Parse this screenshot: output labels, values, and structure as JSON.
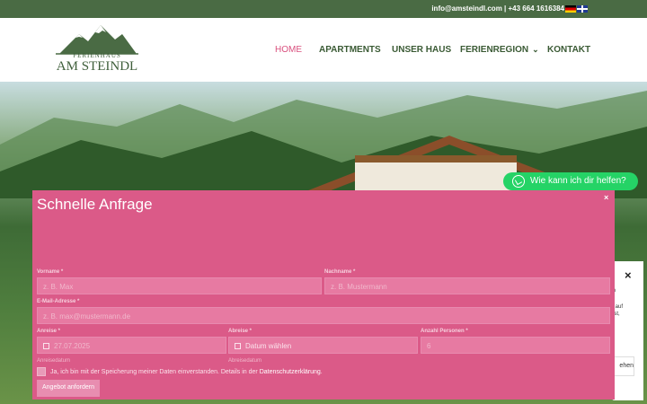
{
  "topbar": {
    "contact": "info@amsteindl.com | +43 664 1616384",
    "languages": [
      "german-flag-icon",
      "english-flag-icon"
    ]
  },
  "logo": {
    "small": "FERIENHAUS",
    "big": "AM STEINDL"
  },
  "nav": [
    {
      "label": "HOME",
      "active": true
    },
    {
      "label": "APARTMENTS"
    },
    {
      "label": "UNSER HAUS"
    },
    {
      "label": "FERIENREGION",
      "has_dropdown": true
    },
    {
      "label": "KONTAKT"
    }
  ],
  "help_widget": {
    "label": "Wie kann ich dir helfen?",
    "icon": "whatsapp-icon"
  },
  "cookie_panel": {
    "close": "×",
    "line1": "m",
    "line2": "s auf",
    "line3": "nst,",
    "line4": ",",
    "button": "ehen"
  },
  "modal": {
    "title": "Schnelle Anfrage",
    "close": "×",
    "fields": {
      "first_name": {
        "label": "Vorname *",
        "placeholder": "z. B. Max"
      },
      "last_name": {
        "label": "Nachname *",
        "placeholder": "z. B. Mustermann"
      },
      "email": {
        "label": "E-Mail-Adresse *",
        "placeholder": "z. B. max@mustermann.de"
      },
      "arrival": {
        "label": "Anreise *",
        "value": "27.07.2025",
        "hint": "Anreisedatum"
      },
      "departure": {
        "label": "Abreise *",
        "placeholder": "Datum wählen",
        "hint": "Abreisedatum"
      },
      "persons": {
        "label": "Anzahl Personen *",
        "value": "6"
      }
    },
    "consent": {
      "text": "Ja, ich bin mit der Speicherung meiner Daten einverstanden. Details in der ",
      "link": "Datenschutzerklärung",
      "tail": "."
    },
    "submit": "Angebot anfordern"
  },
  "colors": {
    "topbar": "#4a6b44",
    "nav_text": "#3a5a34",
    "nav_active": "#d9507e",
    "modal": "#db5a88",
    "whatsapp": "#25d366"
  }
}
